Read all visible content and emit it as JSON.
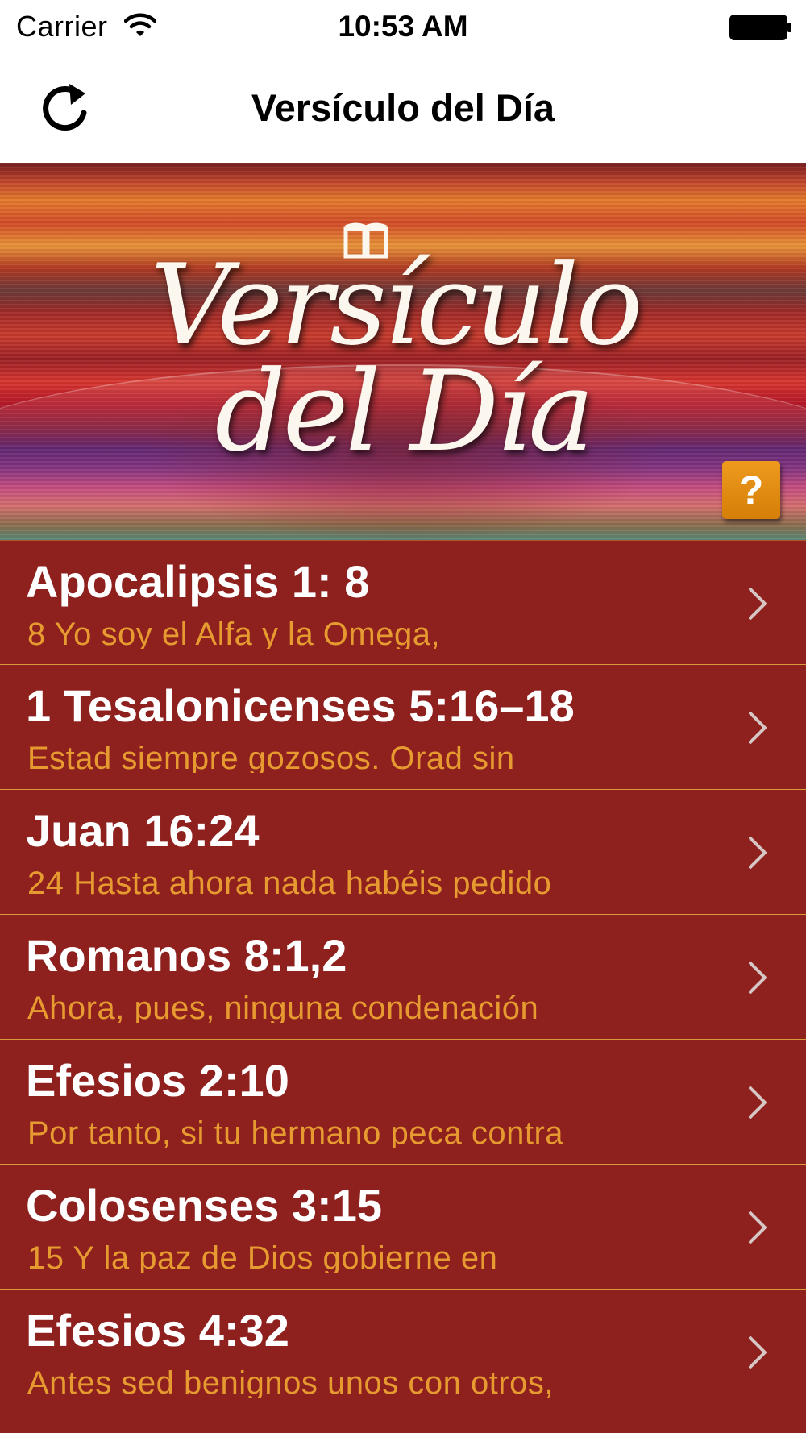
{
  "status_bar": {
    "carrier": "Carrier",
    "time": "10:53 AM",
    "wifi_icon": "wifi-icon",
    "battery_icon": "battery-icon"
  },
  "nav_bar": {
    "title": "Versículo del Día",
    "refresh_icon": "refresh-icon"
  },
  "banner": {
    "logo_line1": "Versículo",
    "logo_line2": "del Día",
    "logo_icon": "open-book-icon",
    "help_label": "?"
  },
  "colors": {
    "list_background": "#8e201e",
    "row_separator": "#d99a3a",
    "reference_text": "#ffffff",
    "snippet_text": "#e69a30",
    "help_button": "#e08a12"
  },
  "verses": [
    {
      "reference": "Apocalipsis 1: 8",
      "snippet": "8 Yo soy el Alfa y la Omega,"
    },
    {
      "reference": "1 Tesalonicenses 5:16–18",
      "snippet": "Estad siempre gozosos. Orad sin"
    },
    {
      "reference": "Juan 16:24",
      "snippet": "24 Hasta ahora nada habéis pedido"
    },
    {
      "reference": "Romanos 8:1,2",
      "snippet": "Ahora, pues, ninguna condenación"
    },
    {
      "reference": "Efesios 2:10",
      "snippet": "Por tanto, si tu hermano peca contra"
    },
    {
      "reference": "Colosenses 3:15",
      "snippet": "15 Y la paz de Dios gobierne en"
    },
    {
      "reference": "Efesios 4:32",
      "snippet": "Antes sed benignos unos con otros,"
    }
  ]
}
